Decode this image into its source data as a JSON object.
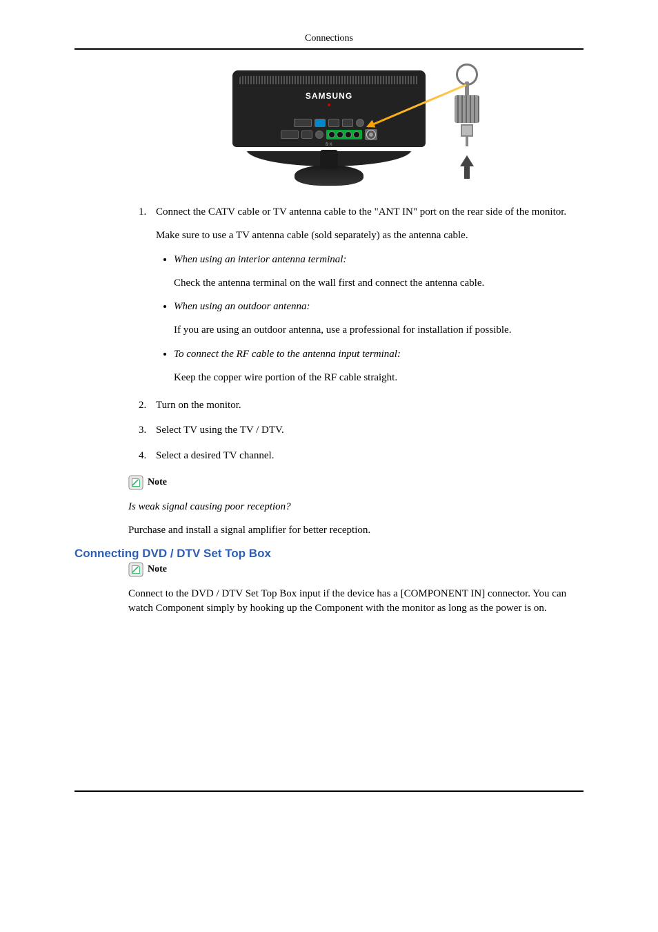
{
  "header": {
    "section_title": "Connections"
  },
  "figure": {
    "brand": "SAMSUNG",
    "bottom_label": "B K",
    "antenna_icon": "antenna-icon",
    "monitor_icon": "monitor-back-icon",
    "arrow_icon": "pointer-arrow-icon",
    "up_arrow_icon": "up-arrow-icon"
  },
  "steps": [
    {
      "text": "Connect the CATV cable or TV antenna cable to the \"ANT IN\" port on the rear side of the monitor.",
      "sub": "Make sure to use a TV antenna cable (sold separately) as the antenna cable.",
      "bullets": [
        {
          "lead": "When using an interior antenna terminal:",
          "follow": "Check the antenna terminal on the wall first and connect the antenna cable."
        },
        {
          "lead": "When using an outdoor antenna:",
          "follow": "If you are using an outdoor antenna, use a professional for installation if possible."
        },
        {
          "lead": "To connect the RF cable to the antenna input terminal:",
          "follow": "Keep the copper wire portion of the RF cable straight."
        }
      ]
    },
    {
      "text": "Turn on the monitor."
    },
    {
      "text": "Select TV using the TV / DTV."
    },
    {
      "text": "Select a desired TV channel."
    }
  ],
  "note1": {
    "label": "Note",
    "question": "Is weak signal causing poor reception?",
    "advice": "Purchase and install a signal amplifier for better reception."
  },
  "section2": {
    "heading": "Connecting DVD / DTV Set Top Box",
    "note_label": "Note",
    "body": "Connect to the DVD / DTV Set Top Box input if the device has a [COMPONENT IN] connector. You can watch Component simply by hooking up the Component with the monitor as long as the power is on."
  }
}
